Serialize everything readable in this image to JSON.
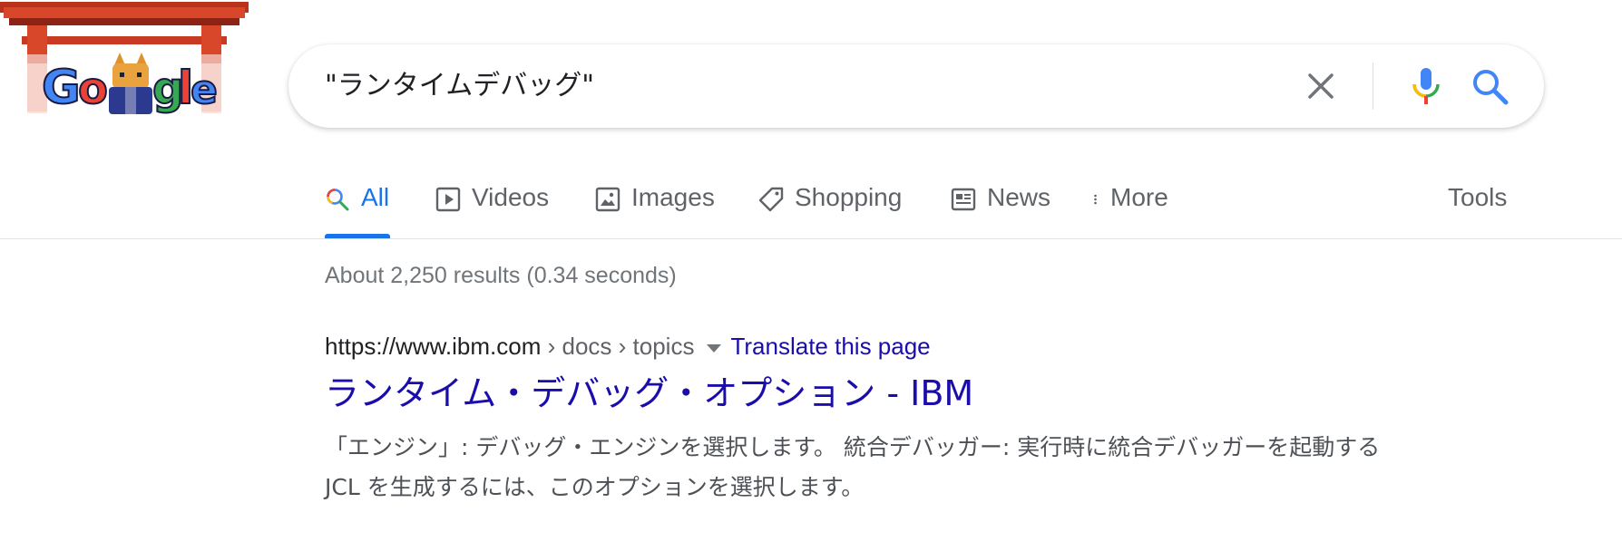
{
  "logo": {
    "text": "Google",
    "alt": "Google doodle"
  },
  "search": {
    "query": "\"ランタイムデバッグ\"",
    "clear_icon": "close-icon",
    "mic_icon": "microphone-icon",
    "search_icon": "search-icon"
  },
  "tabs": [
    {
      "label": "All",
      "icon": "search-icon",
      "active": true
    },
    {
      "label": "Videos",
      "icon": "play-icon"
    },
    {
      "label": "Images",
      "icon": "image-icon"
    },
    {
      "label": "Shopping",
      "icon": "tag-icon"
    },
    {
      "label": "News",
      "icon": "newspaper-icon"
    },
    {
      "label": "More",
      "icon": "more-vert-icon"
    }
  ],
  "tools_label": "Tools",
  "result_stats": "About 2,250 results (0.34 seconds)",
  "results": [
    {
      "url": "https://www.ibm.com",
      "path": " › docs › topics",
      "translate": "Translate this page",
      "title": "ランタイム・デバッグ・オプション - IBM",
      "snippet": "「エンジン」: デバッグ・エンジンを選択します。 統合デバッガー: 実行時に統合デバッガーを起動する JCL を生成するには、このオプションを選択します。"
    }
  ],
  "colors": {
    "link": "#1a0dab",
    "accent": "#1a73e8",
    "muted": "#70757a"
  }
}
